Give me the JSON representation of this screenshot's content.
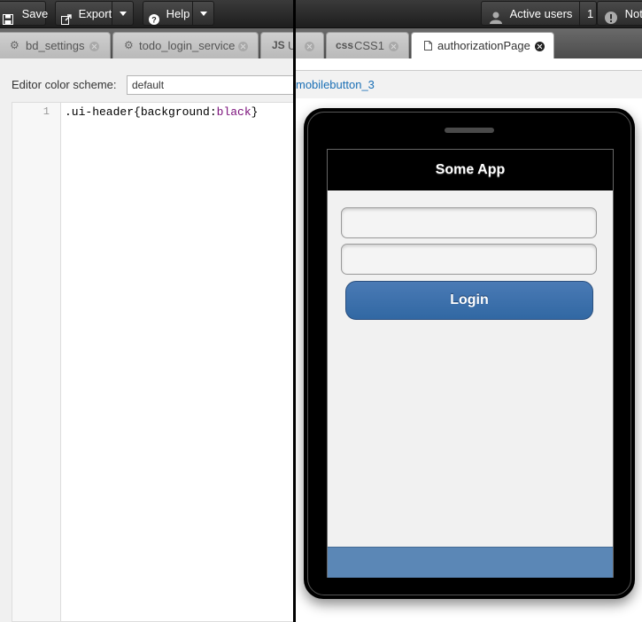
{
  "toolbar": {
    "save_label": "Save",
    "export_label": "Export",
    "help_label": "Help",
    "active_users_label": "Active users",
    "active_users_count": "1",
    "notifications_label": "Noti"
  },
  "tabs": [
    {
      "icon": "gear-icon",
      "label": "bd_settings",
      "active": false
    },
    {
      "icon": "gear-icon",
      "label": "todo_login_service",
      "active": false
    },
    {
      "icon_text": "JS",
      "label": "U",
      "active": false
    },
    {
      "icon_text": "css",
      "label": "CSS1",
      "active": false
    },
    {
      "icon": "page-icon",
      "label": "authorizationPage",
      "active": true
    }
  ],
  "editor": {
    "color_scheme_label": "Editor color scheme:",
    "color_scheme_value": "default",
    "line_number": "1",
    "code": {
      "selector": ".ui-header",
      "open": "{",
      "property": "background:",
      "value": "black",
      "close": "}"
    }
  },
  "preview": {
    "breadcrumb_link": "mobilebutton_3",
    "app_title": "Some App",
    "login_label": "Login"
  },
  "colors": {
    "app_header_bg": "#000000",
    "login_button": "#3a6ea5",
    "footer": "#5b87b6",
    "link": "#1a6fb5"
  }
}
